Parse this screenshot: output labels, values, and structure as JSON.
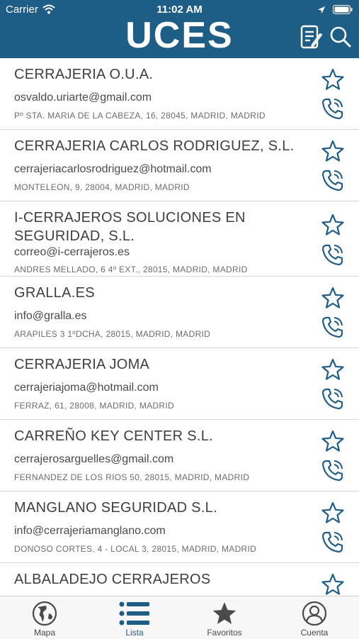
{
  "status_bar": {
    "carrier": "Carrier",
    "time": "11:02 AM"
  },
  "header": {
    "logo": "UCES"
  },
  "contacts": [
    {
      "name": "CERRAJERIA O.U.A.",
      "email": "osvaldo.uriarte@gmail.com",
      "address": "Pº STA. MARIA DE LA CABEZA, 16, 28045, MADRID, MADRID"
    },
    {
      "name": "CERRAJERIA CARLOS RODRIGUEZ, S.L.",
      "email": "cerrajeriacarlosrodriguez@hotmail.com",
      "address": "MONTELEON, 9, 28004, MADRID, MADRID"
    },
    {
      "name": "I-CERRAJEROS SOLUCIONES EN SEGURIDAD, S.L.",
      "email": "correo@i-cerrajeros.es",
      "address": "ANDRES MELLADO, 6 4º EXT., 28015, MADRID, MADRID"
    },
    {
      "name": "GRALLA.ES",
      "email": "info@gralla.es",
      "address": "ARAPILES 3 1ºDCHA, 28015, MADRID, MADRID"
    },
    {
      "name": "CERRAJERIA JOMA",
      "email": "cerrajeriajoma@hotmail.com",
      "address": "FERRAZ, 61, 28008, MADRID, MADRID"
    },
    {
      "name": "CARREÑO KEY CENTER S.L.",
      "email": "cerrajerosarguelles@gmail.com",
      "address": "FERNANDEZ DE LOS RIOS 50, 28015, MADRID, MADRID"
    },
    {
      "name": "MANGLANO SEGURIDAD S.L.",
      "email": "info@cerrajeriamanglano.com",
      "address": "DONOSO CORTES, 4 - LOCAL 3, 28015, MADRID, MADRID"
    },
    {
      "name": "ALBALADEJO CERRAJEROS",
      "email": "",
      "address": ""
    }
  ],
  "tabs": [
    {
      "label": "Mapa",
      "icon": "globe-icon",
      "active": false
    },
    {
      "label": "Lista",
      "icon": "list-icon",
      "active": true
    },
    {
      "label": "Favoritos",
      "icon": "star-icon",
      "active": false
    },
    {
      "label": "Cuenta",
      "icon": "account-icon",
      "active": false
    }
  ],
  "colors": {
    "header": "#1e5d86",
    "accent": "#1e5d86",
    "text": "#3f3f3f"
  }
}
